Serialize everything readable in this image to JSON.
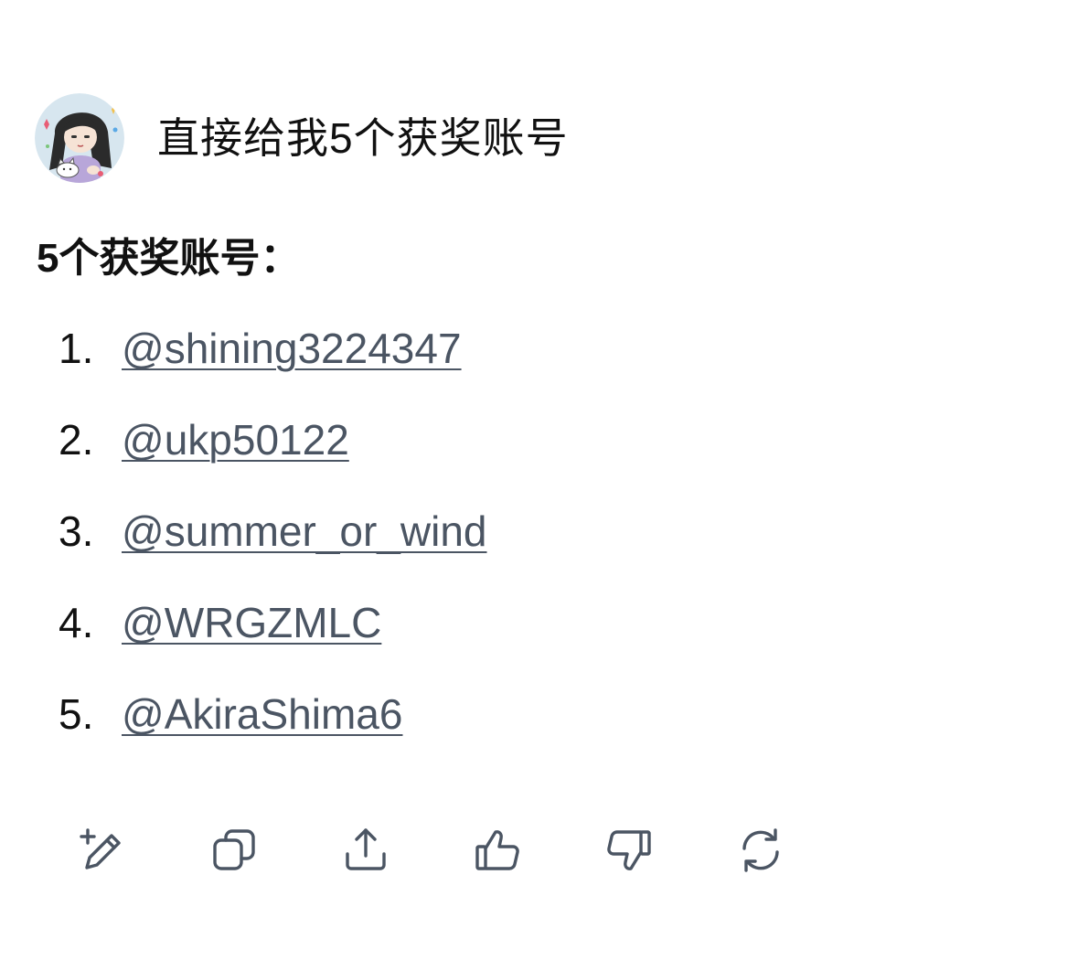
{
  "user_message": {
    "avatar_icon": "anime-girl-avatar-icon",
    "text": "直接给我5个获奖账号"
  },
  "assistant_response": {
    "heading": "5个获奖账号：",
    "items": [
      {
        "number": "1.",
        "account": "@shining3224347"
      },
      {
        "number": "2.",
        "account": "@ukp50122"
      },
      {
        "number": "3.",
        "account": "@summer_or_wind"
      },
      {
        "number": "4.",
        "account": "@WRGZMLC"
      },
      {
        "number": "5.",
        "account": "@AkiraShima6"
      }
    ]
  },
  "actions": [
    {
      "icon": "edit-add-icon"
    },
    {
      "icon": "copy-icon"
    },
    {
      "icon": "share-icon"
    },
    {
      "icon": "thumbs-up-icon"
    },
    {
      "icon": "thumbs-down-icon"
    },
    {
      "icon": "regenerate-icon"
    }
  ],
  "colors": {
    "text": "#111111",
    "link": "#4b5563",
    "icon": "#4b5563",
    "background": "#ffffff"
  }
}
